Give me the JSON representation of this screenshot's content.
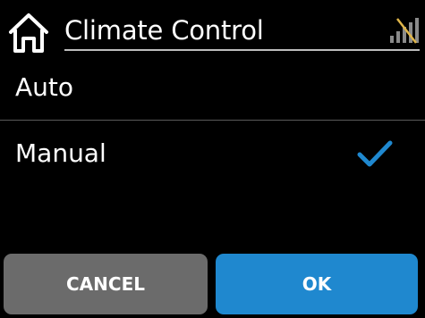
{
  "header": {
    "title": "Climate Control",
    "home_icon": "home-icon",
    "status_icon": "signal-off-icon"
  },
  "options": [
    {
      "label": "Auto",
      "selected": false
    },
    {
      "label": "Manual",
      "selected": true
    }
  ],
  "buttons": {
    "cancel_label": "CANCEL",
    "ok_label": "OK"
  },
  "colors": {
    "background": "#000000",
    "accent": "#1f88cf",
    "cancel_button": "#6b6b6b",
    "check": "#1f88cf",
    "signal_off_slash": "#e0b64a"
  }
}
